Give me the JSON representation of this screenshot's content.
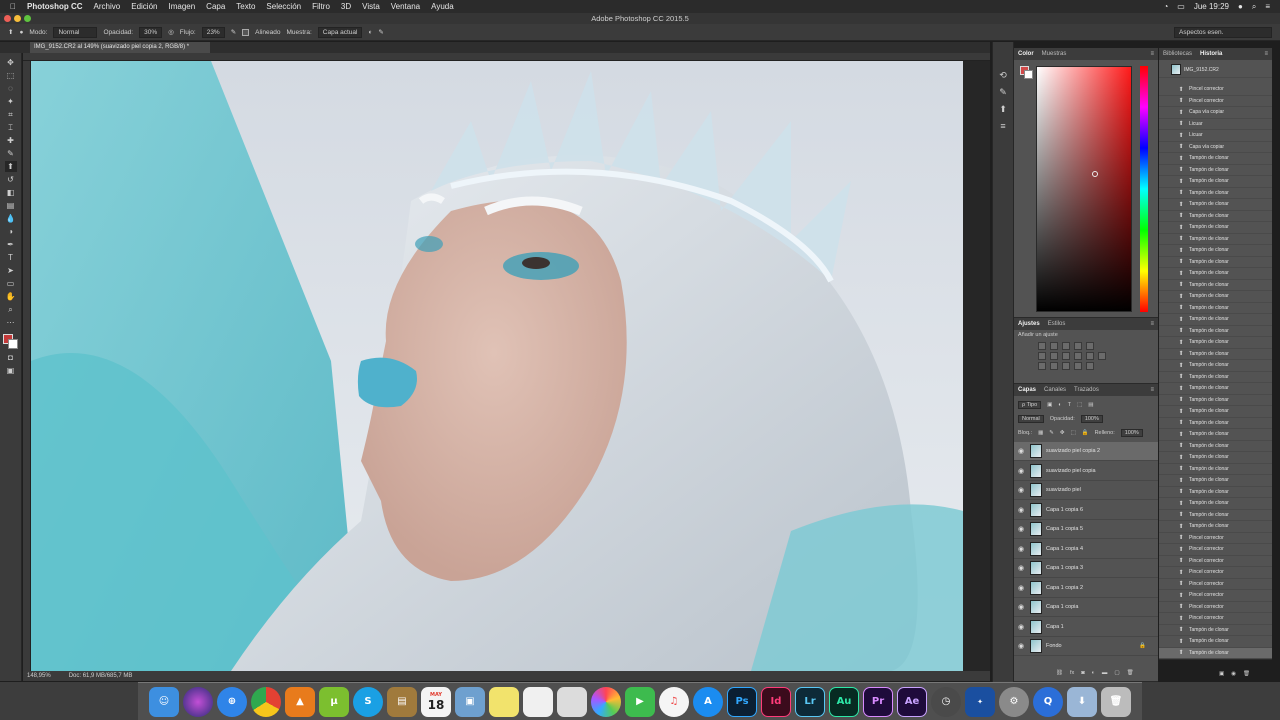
{
  "menubar": {
    "app_name": "Photoshop CC",
    "items": [
      "Archivo",
      "Edición",
      "Imagen",
      "Capa",
      "Texto",
      "Selección",
      "Filtro",
      "3D",
      "Vista",
      "Ventana",
      "Ayuda"
    ],
    "clock": "Jue 19:29"
  },
  "window": {
    "title": "Adobe Photoshop CC 2015.5"
  },
  "optionsbar": {
    "mode_label": "Modo:",
    "mode_value": "Normal",
    "opacity_label": "Opacidad:",
    "opacity_value": "30%",
    "flow_label": "Flujo:",
    "flow_value": "23%",
    "aligned_label": "Alineado",
    "sample_label": "Muestra:",
    "sample_value": "Capa actual",
    "workspace": "Aspectos esen."
  },
  "document": {
    "tab_title": "IMG_9152.CR2 al 149% (suavizado piel copia 2, RGB/8) *",
    "zoom": "148,95%",
    "doc_size": "Doc: 61,9 MB/685,7 MB"
  },
  "color_panel": {
    "tabs": [
      "Color",
      "Muestras"
    ],
    "foreground": "#d14a4a",
    "background": "#ffffff"
  },
  "adjustments_panel": {
    "tabs": [
      "Ajustes",
      "Estilos"
    ],
    "label": "Añadir un ajuste"
  },
  "layers_panel": {
    "tabs": [
      "Capas",
      "Canales",
      "Trazados"
    ],
    "filter_label": "ρ Tipo",
    "blend_mode": "Normal",
    "opacity_label": "Opacidad:",
    "opacity_value": "100%",
    "lock_label": "Bloq.:",
    "fill_label": "Relleno:",
    "fill_value": "100%",
    "layers": [
      {
        "name": "suavizado piel copia 2",
        "selected": true
      },
      {
        "name": "suavizado piel copia",
        "selected": false
      },
      {
        "name": "suavizado piel",
        "selected": false
      },
      {
        "name": "Capa 1 copia 6",
        "selected": false
      },
      {
        "name": "Capa 1 copia 5",
        "selected": false
      },
      {
        "name": "Capa 1 copia 4",
        "selected": false
      },
      {
        "name": "Capa 1 copia 3",
        "selected": false
      },
      {
        "name": "Capa 1 copia 2",
        "selected": false
      },
      {
        "name": "Capa 1 copia",
        "selected": false
      },
      {
        "name": "Capa 1",
        "selected": false
      },
      {
        "name": "Fondo",
        "selected": false
      }
    ]
  },
  "history_panel": {
    "tabs": [
      "Bibliotecas",
      "Historia"
    ],
    "snapshot": "IMG_9152.CR2",
    "items": [
      "Pincel corrector",
      "Pincel corrector",
      "Capa vía copiar",
      "Licuar",
      "Licuar",
      "Capa vía copiar",
      "Tampón de clonar",
      "Tampón de clonar",
      "Tampón de clonar",
      "Tampón de clonar",
      "Tampón de clonar",
      "Tampón de clonar",
      "Tampón de clonar",
      "Tampón de clonar",
      "Tampón de clonar",
      "Tampón de clonar",
      "Tampón de clonar",
      "Tampón de clonar",
      "Tampón de clonar",
      "Tampón de clonar",
      "Tampón de clonar",
      "Tampón de clonar",
      "Tampón de clonar",
      "Tampón de clonar",
      "Tampón de clonar",
      "Tampón de clonar",
      "Tampón de clonar",
      "Tampón de clonar",
      "Tampón de clonar",
      "Tampón de clonar",
      "Tampón de clonar",
      "Tampón de clonar",
      "Tampón de clonar",
      "Tampón de clonar",
      "Tampón de clonar",
      "Tampón de clonar",
      "Tampón de clonar",
      "Tampón de clonar",
      "Tampón de clonar",
      "Pincel corrector",
      "Pincel corrector",
      "Pincel corrector",
      "Pincel corrector",
      "Pincel corrector",
      "Pincel corrector",
      "Pincel corrector",
      "Pincel corrector",
      "Tampón de clonar",
      "Tampón de clonar",
      "Tampón de clonar"
    ]
  },
  "dock": {
    "calendar_month": "MAY",
    "calendar_day": "18",
    "apps": [
      "Finder",
      "Siri",
      "Safari",
      "Chrome",
      "VLC",
      "uTorrent",
      "Skype",
      "Notes",
      "Preview",
      "Stickies",
      "TextEdit",
      "Photos",
      "Photos2",
      "FaceTime",
      "iTunes",
      "App Store",
      "Photoshop",
      "InDesign",
      "Lightroom",
      "Audition",
      "Premiere",
      "After Effects",
      "Clock",
      "Battle.net",
      "System Preferences",
      "QuickTime",
      "Downloads",
      "Trash"
    ],
    "labels": {
      "ps": "Ps",
      "id": "Id",
      "lr": "Lr",
      "au": "Au",
      "pr": "Pr",
      "ae": "Ae"
    }
  }
}
